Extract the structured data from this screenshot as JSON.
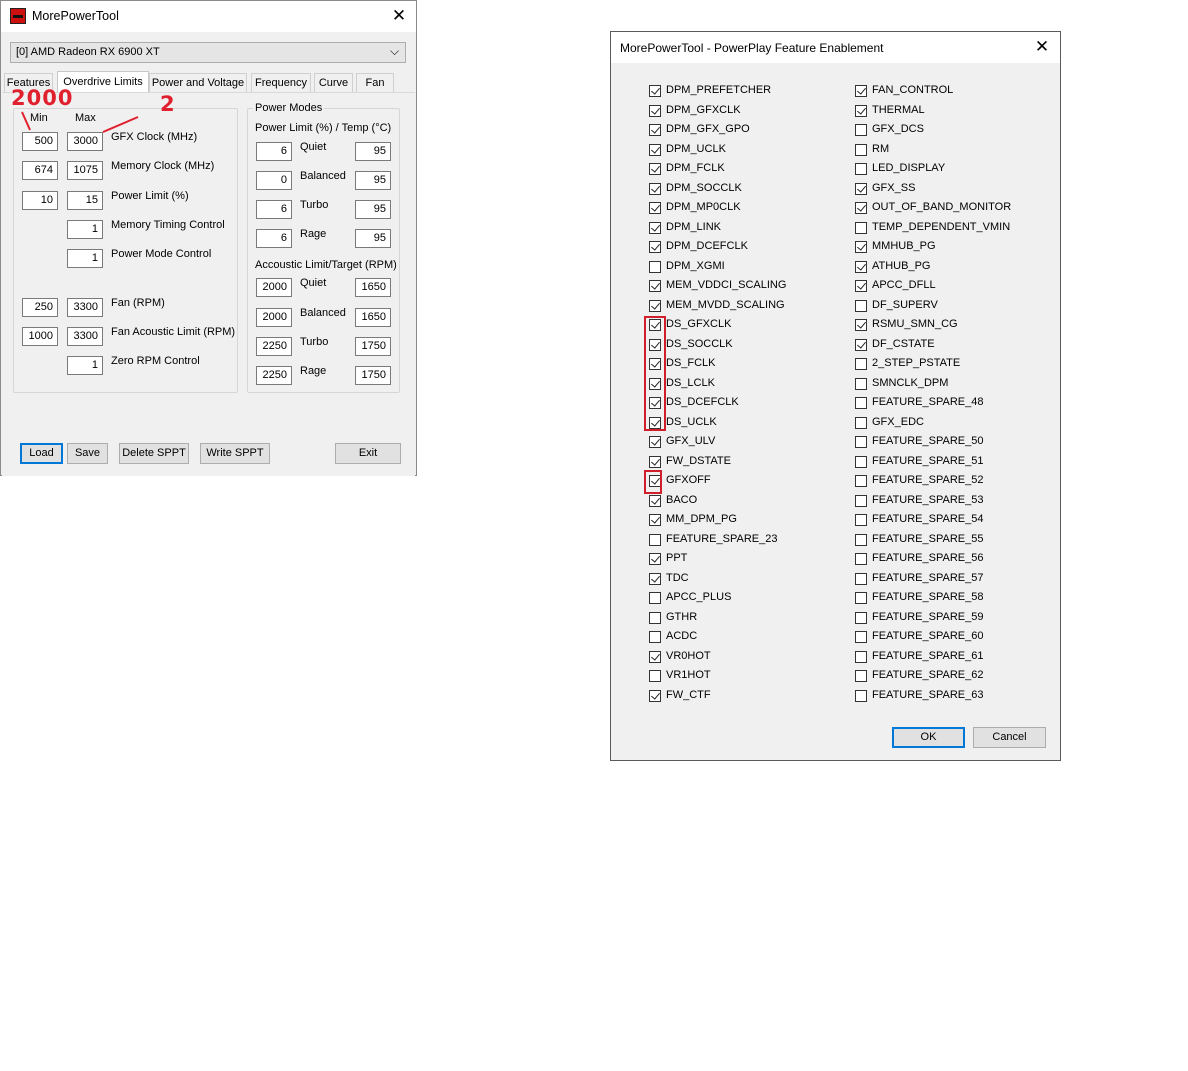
{
  "win1": {
    "title": "MorePowerTool",
    "gpu_select": "[0] AMD Radeon RX 6900 XT",
    "tabs": [
      {
        "label": "Features",
        "active": false
      },
      {
        "label": "Overdrive Limits",
        "active": true
      },
      {
        "label": "Power and Voltage",
        "active": false
      },
      {
        "label": "Frequency",
        "active": false
      },
      {
        "label": "Curve",
        "active": false
      },
      {
        "label": "Fan",
        "active": false
      }
    ],
    "headers": {
      "min": "Min",
      "max": "Max"
    },
    "rows": [
      {
        "min": "500",
        "max": "3000",
        "label": "GFX Clock (MHz)"
      },
      {
        "min": "674",
        "max": "1075",
        "label": "Memory Clock (MHz)"
      },
      {
        "min": "10",
        "max": "15",
        "label": "Power Limit (%)"
      },
      {
        "min": "",
        "max": "1",
        "label": "Memory Timing Control"
      },
      {
        "min": "",
        "max": "1",
        "label": "Power Mode Control"
      },
      {
        "min": "250",
        "max": "3300",
        "label": "Fan (RPM)"
      },
      {
        "min": "1000",
        "max": "3300",
        "label": "Fan Acoustic Limit (RPM)"
      },
      {
        "min": "",
        "max": "1",
        "label": "Zero RPM Control"
      }
    ],
    "power_modes": {
      "group_title": "Power Modes",
      "power_header": "Power Limit (%) / Temp (°C)",
      "power_rows": [
        {
          "a": "6",
          "mode": "Quiet",
          "b": "95"
        },
        {
          "a": "0",
          "mode": "Balanced",
          "b": "95"
        },
        {
          "a": "6",
          "mode": "Turbo",
          "b": "95"
        },
        {
          "a": "6",
          "mode": "Rage",
          "b": "95"
        }
      ],
      "acoustic_header": "Accoustic Limit/Target (RPM)",
      "acoustic_rows": [
        {
          "a": "2000",
          "mode": "Quiet",
          "b": "1650"
        },
        {
          "a": "2000",
          "mode": "Balanced",
          "b": "1650"
        },
        {
          "a": "2250",
          "mode": "Turbo",
          "b": "1750"
        },
        {
          "a": "2250",
          "mode": "Rage",
          "b": "1750"
        }
      ]
    },
    "buttons": {
      "load": "Load",
      "save": "Save",
      "delete": "Delete SPPT",
      "write": "Write SPPT",
      "exit": "Exit"
    },
    "annotations": {
      "min_note": "2000",
      "max_note": "2"
    }
  },
  "win2": {
    "title": "MorePowerTool - PowerPlay Feature Enablement",
    "left_col": [
      {
        "label": "DPM_PREFETCHER",
        "checked": true
      },
      {
        "label": "DPM_GFXCLK",
        "checked": true
      },
      {
        "label": "DPM_GFX_GPO",
        "checked": true
      },
      {
        "label": "DPM_UCLK",
        "checked": true
      },
      {
        "label": "DPM_FCLK",
        "checked": true
      },
      {
        "label": "DPM_SOCCLK",
        "checked": true
      },
      {
        "label": "DPM_MP0CLK",
        "checked": true
      },
      {
        "label": "DPM_LINK",
        "checked": true
      },
      {
        "label": "DPM_DCEFCLK",
        "checked": true
      },
      {
        "label": "DPM_XGMI",
        "checked": false
      },
      {
        "label": "MEM_VDDCI_SCALING",
        "checked": true
      },
      {
        "label": "MEM_MVDD_SCALING",
        "checked": true
      },
      {
        "label": "DS_GFXCLK",
        "checked": true
      },
      {
        "label": "DS_SOCCLK",
        "checked": true
      },
      {
        "label": "DS_FCLK",
        "checked": true
      },
      {
        "label": "DS_LCLK",
        "checked": true
      },
      {
        "label": "DS_DCEFCLK",
        "checked": true
      },
      {
        "label": "DS_UCLK",
        "checked": true
      },
      {
        "label": "GFX_ULV",
        "checked": true
      },
      {
        "label": "FW_DSTATE",
        "checked": true
      },
      {
        "label": "GFXOFF",
        "checked": true
      },
      {
        "label": "BACO",
        "checked": true
      },
      {
        "label": "MM_DPM_PG",
        "checked": true
      },
      {
        "label": "FEATURE_SPARE_23",
        "checked": false
      },
      {
        "label": "PPT",
        "checked": true
      },
      {
        "label": "TDC",
        "checked": true
      },
      {
        "label": "APCC_PLUS",
        "checked": false
      },
      {
        "label": "GTHR",
        "checked": false
      },
      {
        "label": "ACDC",
        "checked": false
      },
      {
        "label": "VR0HOT",
        "checked": true
      },
      {
        "label": "VR1HOT",
        "checked": false
      },
      {
        "label": "FW_CTF",
        "checked": true
      }
    ],
    "right_col": [
      {
        "label": "FAN_CONTROL",
        "checked": true
      },
      {
        "label": "THERMAL",
        "checked": true
      },
      {
        "label": "GFX_DCS",
        "checked": false
      },
      {
        "label": "RM",
        "checked": false
      },
      {
        "label": "LED_DISPLAY",
        "checked": false
      },
      {
        "label": "GFX_SS",
        "checked": true
      },
      {
        "label": "OUT_OF_BAND_MONITOR",
        "checked": true
      },
      {
        "label": "TEMP_DEPENDENT_VMIN",
        "checked": false
      },
      {
        "label": "MMHUB_PG",
        "checked": true
      },
      {
        "label": "ATHUB_PG",
        "checked": true
      },
      {
        "label": "APCC_DFLL",
        "checked": true
      },
      {
        "label": "DF_SUPERV",
        "checked": false
      },
      {
        "label": "RSMU_SMN_CG",
        "checked": true
      },
      {
        "label": "DF_CSTATE",
        "checked": true
      },
      {
        "label": "2_STEP_PSTATE",
        "checked": false
      },
      {
        "label": "SMNCLK_DPM",
        "checked": false
      },
      {
        "label": "FEATURE_SPARE_48",
        "checked": false
      },
      {
        "label": "GFX_EDC",
        "checked": false
      },
      {
        "label": "FEATURE_SPARE_50",
        "checked": false
      },
      {
        "label": "FEATURE_SPARE_51",
        "checked": false
      },
      {
        "label": "FEATURE_SPARE_52",
        "checked": false
      },
      {
        "label": "FEATURE_SPARE_53",
        "checked": false
      },
      {
        "label": "FEATURE_SPARE_54",
        "checked": false
      },
      {
        "label": "FEATURE_SPARE_55",
        "checked": false
      },
      {
        "label": "FEATURE_SPARE_56",
        "checked": false
      },
      {
        "label": "FEATURE_SPARE_57",
        "checked": false
      },
      {
        "label": "FEATURE_SPARE_58",
        "checked": false
      },
      {
        "label": "FEATURE_SPARE_59",
        "checked": false
      },
      {
        "label": "FEATURE_SPARE_60",
        "checked": false
      },
      {
        "label": "FEATURE_SPARE_61",
        "checked": false
      },
      {
        "label": "FEATURE_SPARE_62",
        "checked": false
      },
      {
        "label": "FEATURE_SPARE_63",
        "checked": false
      }
    ],
    "buttons": {
      "ok": "OK",
      "cancel": "Cancel"
    }
  },
  "colors": {
    "annotation": "#e0202e",
    "focus_border": "#0078d7",
    "dialog_bg": "#f0f0f0"
  },
  "icons": {
    "app": "app-logo-icon",
    "close": "close-icon",
    "dropdown": "chevron-down-icon"
  }
}
